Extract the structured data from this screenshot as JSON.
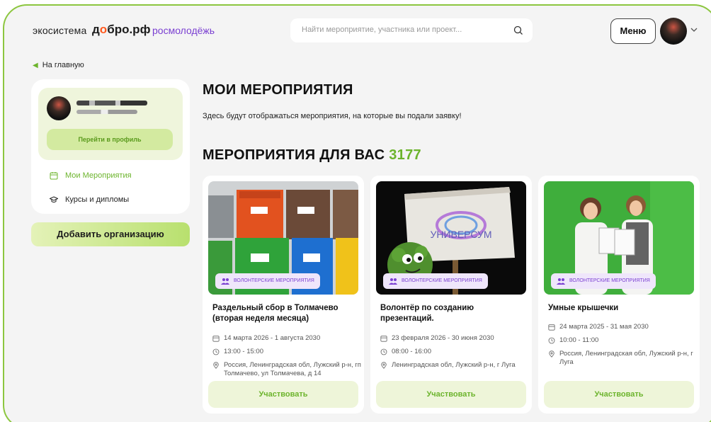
{
  "header": {
    "logo_eco": "экосистема",
    "logo_dobro_pre": "д",
    "logo_dobro_heart": "о",
    "logo_dobro_post": "бро.рф",
    "logo_rosmol": "росмолодёжь",
    "search_placeholder": "Найти мероприятие, участника или проект...",
    "menu_label": "Меню"
  },
  "back_link": "На главную",
  "sidebar": {
    "profile_button": "Перейти в профиль",
    "items": [
      {
        "label": "Мои Мероприятия",
        "icon": "calendar-icon",
        "active": true
      },
      {
        "label": "Курсы и дипломы",
        "icon": "graduation-cap-icon",
        "active": false
      }
    ],
    "add_org": "Добавить организацию"
  },
  "main": {
    "my_events_title": "МОИ МЕРОПРИЯТИЯ",
    "my_events_sub": "Здесь будут отображаться мероприятия, на которые вы подали заявку!",
    "for_you_title": "МЕРОПРИЯТИЯ ДЛЯ ВАС",
    "for_you_count": "3177"
  },
  "cards": [
    {
      "tag": "ВОЛОНТЕРСКИЕ МЕРОПРИЯТИЯ",
      "title": "Раздельный сбор в Толмачево (вторая неделя месяца)",
      "date": "14 марта 2026 - 1 августа 2030",
      "time": "13:00 - 15:00",
      "place": "Россия, Ленинградская обл, Лужский р-н, гп Толмачево, ул Толмачева, д 14",
      "button": "Участвовать"
    },
    {
      "tag": "ВОЛОНТЕРСКИЕ МЕРОПРИЯТИЯ",
      "title": "Волонтёр по созданию презентаций.",
      "date": "23 февраля 2026 - 30 июня 2030",
      "time": "08:00 - 16:00",
      "place": "Ленинградская обл, Лужский р-н, г Луга",
      "image_sign": "УНИВЕРСУМ",
      "button": "Участвовать"
    },
    {
      "tag": "ВОЛОНТЕРСКИЕ МЕРОПРИЯТИЯ",
      "title": "Умные крышечки",
      "date": "24 марта 2025 - 31 мая 2030",
      "time": "10:00 - 11:00",
      "place": "Россия, Ленинградская обл, Лужский р-н, г Луга",
      "button": "Участвовать"
    }
  ],
  "colors": {
    "accent_green": "#6cb42c",
    "frame_green": "#8cc63f",
    "tag_purple": "#7a3fd1"
  }
}
